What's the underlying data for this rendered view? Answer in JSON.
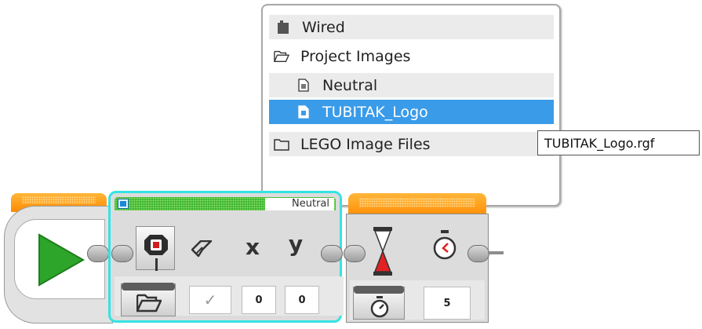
{
  "image_picker": {
    "items": [
      {
        "label": "Wired",
        "icon": "brick-icon"
      },
      {
        "label": "Project Images",
        "icon": "folder-open-icon"
      },
      {
        "label": "Neutral",
        "icon": "image-file-icon"
      },
      {
        "label": "TUBITAK_Logo",
        "icon": "image-file-icon",
        "selected": true
      },
      {
        "label": "LEGO Image Files",
        "icon": "folder-icon"
      }
    ],
    "tooltip": "TUBITAK_Logo.rgf"
  },
  "display_block": {
    "file_name": "Neutral",
    "mode_icon": "display-image-icon",
    "params": {
      "clear_label": "eraser-icon",
      "x_label": "x",
      "y_label": "y"
    },
    "values": {
      "clear": "✓",
      "x": "0",
      "y": "0"
    }
  },
  "wait_block": {
    "mode_icon": "hourglass-icon",
    "param_icon": "stopwatch-icon",
    "values": {
      "seconds": "5"
    }
  },
  "colors": {
    "selection": "#3a9be9",
    "accent_orange": "#ff9900",
    "accent_green": "#32b028",
    "highlight_cyan": "#35e3e3"
  }
}
